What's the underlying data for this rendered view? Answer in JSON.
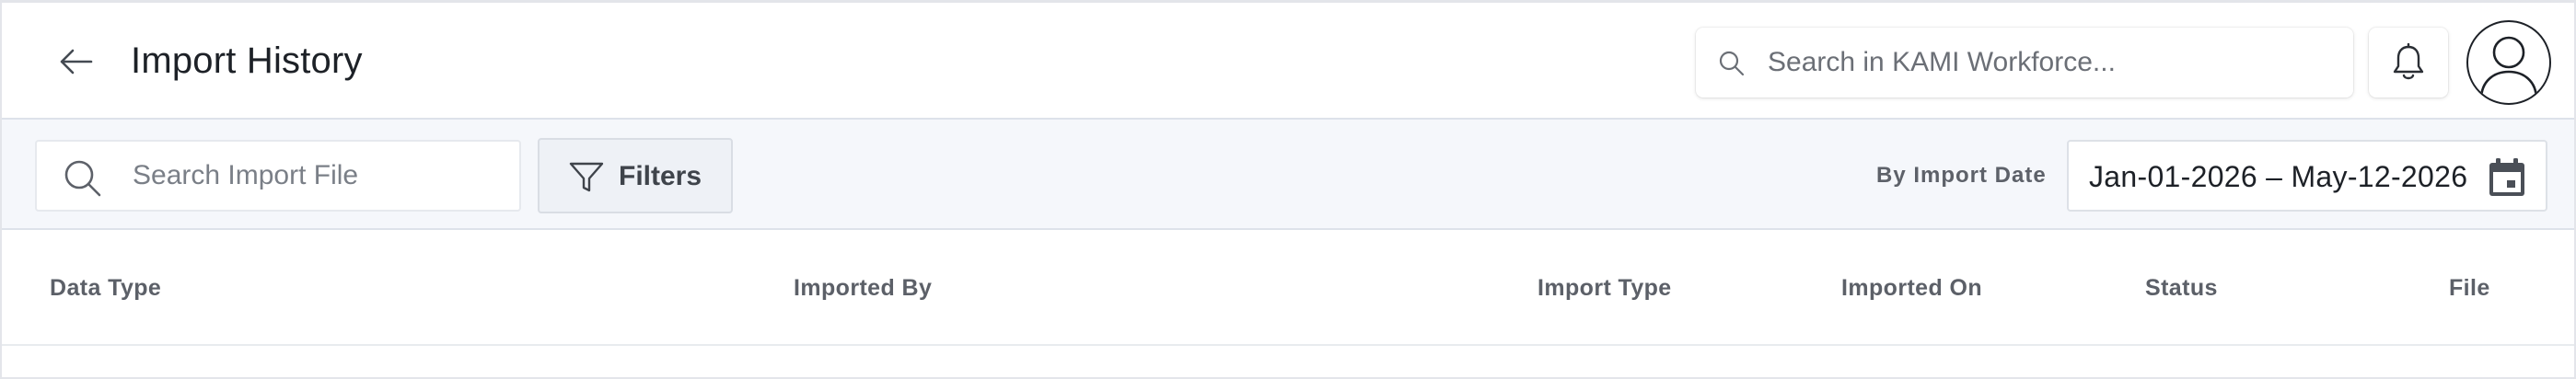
{
  "header": {
    "title": "Import History",
    "back_icon": "arrow-left-icon",
    "global_search": {
      "placeholder": "Search in KAMI Workforce...",
      "value": "",
      "icon": "search-icon"
    },
    "notifications_icon": "bell-icon",
    "avatar_icon": "user-avatar-icon"
  },
  "toolbar": {
    "file_search": {
      "placeholder": "Search Import File",
      "value": "",
      "icon": "search-icon"
    },
    "filters_label": "Filters",
    "filters_icon": "funnel-icon",
    "date_filter_label": "By Import Date",
    "date_range": "Jan-01-2026 – May-12-2026",
    "calendar_icon": "calendar-icon"
  },
  "table": {
    "columns": [
      "Data Type",
      "Imported By",
      "Import Type",
      "Imported On",
      "Status",
      "File"
    ],
    "rows": []
  },
  "colors": {
    "header_bg": "#ffffff",
    "toolbar_bg": "#f5f7fb",
    "border": "#dde2ea",
    "text_primary": "#1d2127",
    "text_muted": "#5c6068"
  }
}
